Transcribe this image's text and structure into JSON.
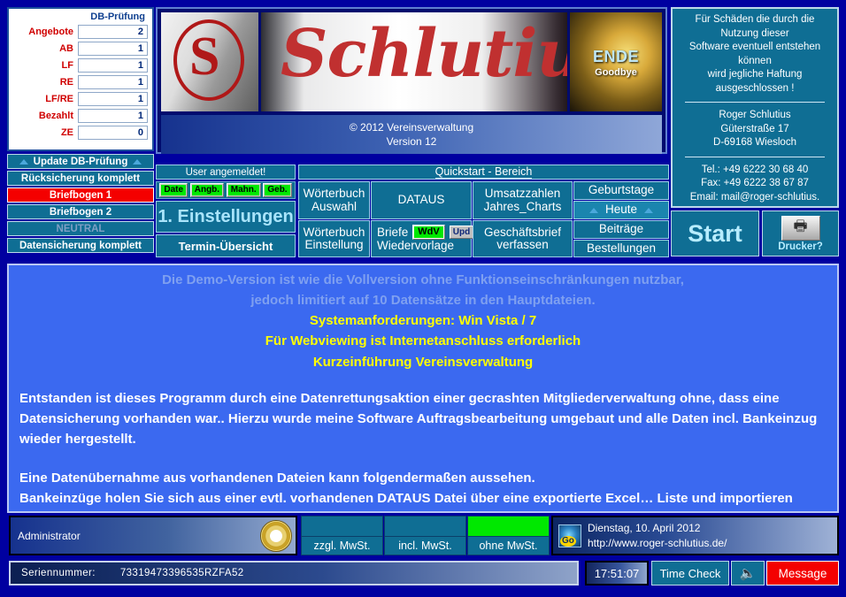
{
  "db_check": {
    "header": "DB-Prüfung",
    "rows": [
      {
        "label": "Angebote",
        "value": "2"
      },
      {
        "label": "AB",
        "value": "1"
      },
      {
        "label": "LF",
        "value": "1"
      },
      {
        "label": "RE",
        "value": "1"
      },
      {
        "label": "LF/RE",
        "value": "1"
      },
      {
        "label": "Bezahlt",
        "value": "1"
      },
      {
        "label": "ZE",
        "value": "0"
      }
    ]
  },
  "sidebar": {
    "update_db": "Update DB-Prüfung",
    "restore": "Rücksicherung komplett",
    "letterhead1": "Briefbogen 1",
    "letterhead2": "Briefbogen 2",
    "neutral": "NEUTRAL",
    "backup": "Datensicherung komplett"
  },
  "banner": {
    "logo_letter": "S",
    "script_word": "Schlutius",
    "end_label": "ENDE",
    "end_sub": "Goodbye",
    "copyright": "© 2012 Vereinsverwaltung",
    "version": "Version 12"
  },
  "user": {
    "status": "User angemeldet!",
    "tags": [
      "Date",
      "Angb.",
      "Mahn.",
      "Geb."
    ],
    "settings": "1. Einstellungen",
    "appointments": "Termin-Übersicht"
  },
  "quickstart": {
    "header": "Quickstart - Bereich",
    "dictionary_select_l1": "Wörterbuch",
    "dictionary_select_l2": "Auswahl",
    "dictionary_setting_l1": "Wörterbuch",
    "dictionary_setting_l2": "Einstellung",
    "dataus": "DATAUS",
    "letters_l1": "Briefe",
    "letters_badge_wdv": "WdV",
    "letters_badge_upd": "Upd",
    "letters_l2": "Wiedervorlage",
    "sales_l1": "Umsatzzahlen",
    "sales_l2": "Jahres_Charts",
    "business_l1": "Geschäftsbrief",
    "business_l2": "verfassen",
    "birthdays": "Geburtstage",
    "today": "Heute",
    "contributions": "Beiträge",
    "orders": "Bestellungen"
  },
  "info": {
    "disclaimer_l1": "Für Schäden die durch die",
    "disclaimer_l2": "Nutzung dieser",
    "disclaimer_l3": "Software eventuell entstehen",
    "disclaimer_l4": "können",
    "disclaimer_l5": "wird jegliche Haftung",
    "disclaimer_l6": "ausgeschlossen !",
    "name": "Roger Schlutius",
    "street": "Güterstraße 17",
    "city": "D-69168 Wiesloch",
    "tel": "Tel.: +49 6222 30 68 40",
    "fax": "Fax: +49 6222 38 67 87",
    "email": "Email: mail@roger-schlutius."
  },
  "actions": {
    "start": "Start",
    "printer": "Drucker?"
  },
  "main_text": {
    "dim_l1": "Die Demo-Version ist wie die Vollversion ohne Funktionseinschränkungen nutzbar,",
    "dim_l2": "jedoch limitiert auf 10 Datensätze in den Hauptdateien.",
    "yellow_l1": "Systemanforderungen: Win Vista / 7",
    "yellow_l2": "Für Webviewing ist Internetanschluss erforderlich",
    "yellow_l3": "Kurzeinführung Vereinsverwaltung",
    "body_p1": "Entstanden ist dieses Programm durch eine Datenrettungsaktion einer gecrashten Mitgliederverwaltung ohne, dass eine Datensicherung vorhanden war.. Hierzu wurde meine Software Auftragsbearbeitung umgebaut und alle Daten incl. Bankeinzug wieder hergestellt.",
    "body_p2": "Eine Datenübernahme aus vorhandenen Dateien kann folgendermaßen aussehen.",
    "body_p3": "Bankeinzüge holen Sie sich aus einer evtl. vorhandenen DATAUS Datei über eine exportierte Excel… Liste und importieren diese mit den passenden Feldern in die DATAUS Datei dieser Software. Außer dem Betrag sollte"
  },
  "bottom": {
    "admin": "Administrator",
    "vat": [
      {
        "label": "zzgl. MwSt.",
        "active": false
      },
      {
        "label": "incl. MwSt.",
        "active": false
      },
      {
        "label": "ohne MwSt.",
        "active": true
      }
    ],
    "date": "Dienstag, 10. April 2012",
    "url": "http://www.roger-schlutius.de/",
    "serial_label": "Seriennummer:",
    "serial_value": "73319473396535RZFA52",
    "clock": "17:51:07",
    "time_check": "Time Check",
    "message": "Message"
  },
  "colors": {
    "teal": "#0f6e94",
    "red": "#f40000",
    "green": "#00e800",
    "yellow": "#ffff00",
    "navy": "#0000a0",
    "panel_blue": "#3b69f0"
  }
}
